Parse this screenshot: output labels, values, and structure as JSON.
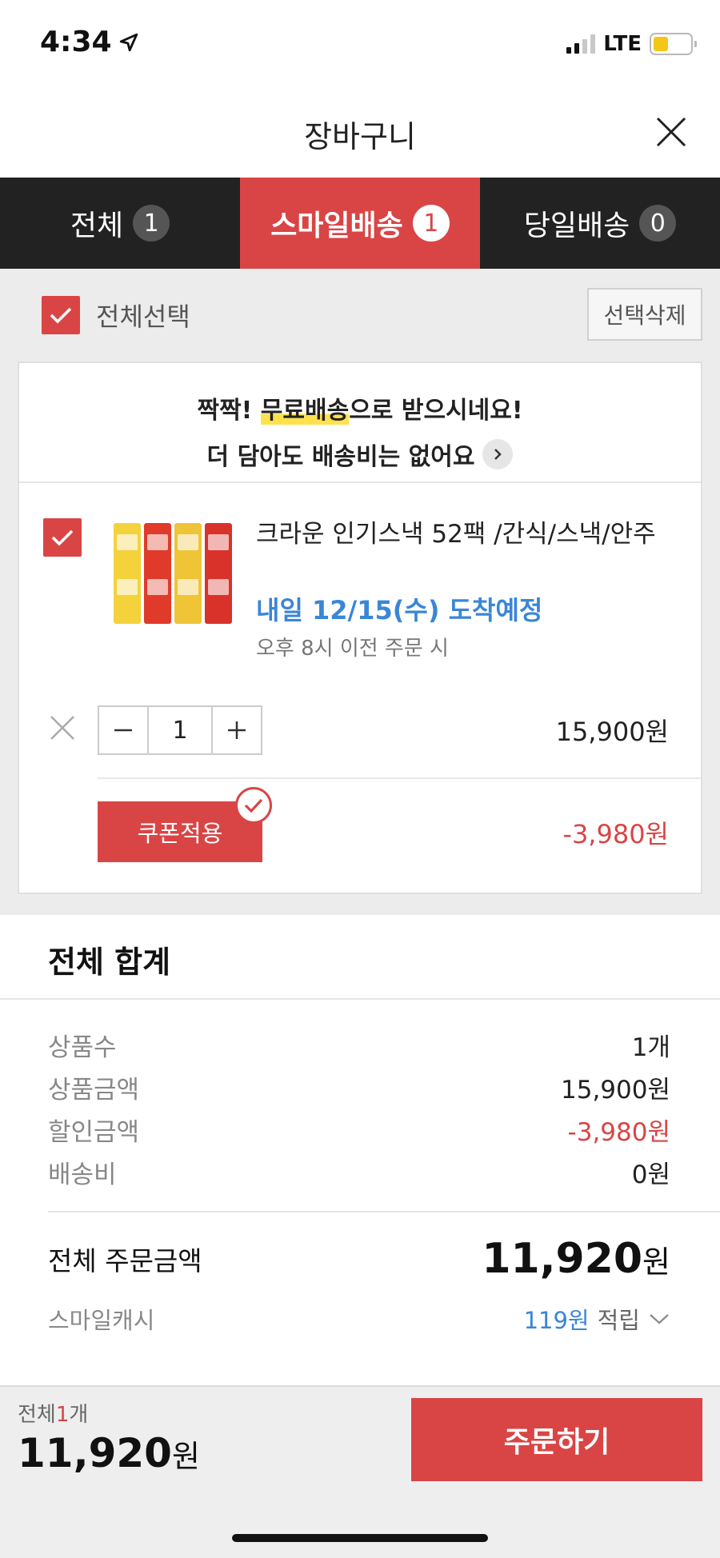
{
  "status": {
    "time": "4:34",
    "network": "LTE"
  },
  "header": {
    "title": "장바구니"
  },
  "tabs": [
    {
      "label": "전체",
      "count": "1"
    },
    {
      "label": "스마일배송",
      "count": "1",
      "active": true
    },
    {
      "label": "당일배송",
      "count": "0"
    }
  ],
  "selection": {
    "select_all_label": "전체선택",
    "delete_label": "선택삭제"
  },
  "shipping_notice": {
    "prefix": "짝짝! ",
    "highlight": "무료배송",
    "suffix": "으로 받으시네요!",
    "line2": "더 담아도 배송비는 없어요"
  },
  "item": {
    "name": "크라운 인기스낵 52팩 /간식/스낵/안주",
    "arrival": "내일 12/15(수) 도착예정",
    "arrival_note": "오후 8시 이전 주문 시",
    "quantity": "1",
    "price": "15,900원",
    "coupon_label": "쿠폰적용",
    "discount": "-3,980원"
  },
  "summary": {
    "title": "전체 합계",
    "rows": [
      {
        "label": "상품수",
        "value": "1개"
      },
      {
        "label": "상품금액",
        "value": "15,900원"
      },
      {
        "label": "할인금액",
        "value": "-3,980원"
      },
      {
        "label": "배송비",
        "value": "0원"
      }
    ],
    "total_label": "전체 주문금액",
    "total_number": "11,920",
    "total_unit": "원",
    "cash_label": "스마일캐시",
    "cash_amount": "119원",
    "cash_suffix": "적립"
  },
  "bottom": {
    "count_prefix": "전체",
    "count_num": "1",
    "count_suffix": "개",
    "total_number": "11,920",
    "total_unit": "원",
    "order_label": "주문하기"
  },
  "colors": {
    "accent": "#d94545",
    "blue": "#3a86d6",
    "tab_bg": "#222222"
  }
}
